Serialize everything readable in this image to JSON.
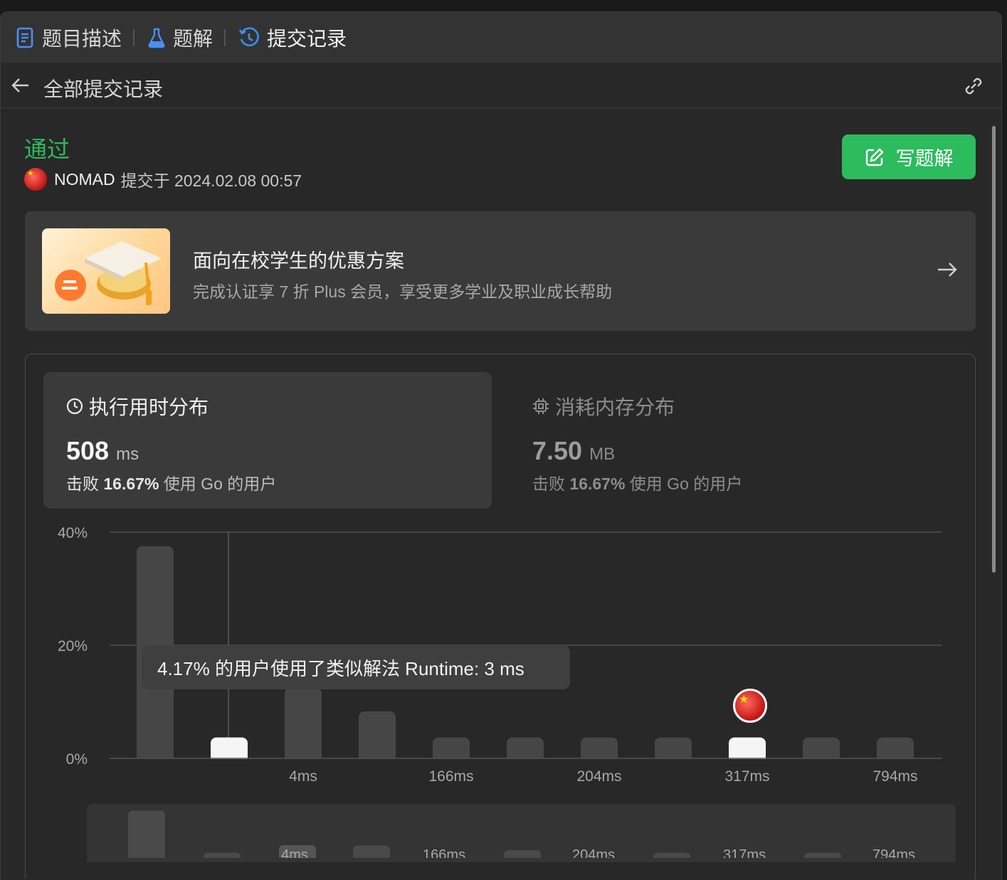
{
  "tabs": [
    {
      "label": "题目描述",
      "icon": "document-icon"
    },
    {
      "label": "题解",
      "icon": "flask-icon"
    },
    {
      "label": "提交记录",
      "icon": "history-icon"
    }
  ],
  "subheader": {
    "title": "全部提交记录"
  },
  "submission": {
    "status": "通过",
    "user": "NOMAD",
    "submitted_text": "提交于 2024.02.08 00:57",
    "status_color": "#2cbb5d"
  },
  "write_button": {
    "label": "写题解"
  },
  "promo": {
    "title": "面向在校学生的优惠方案",
    "subtitle": "完成认证享 7 折 Plus 会员，享受更多学业及职业成长帮助"
  },
  "stats": {
    "runtime": {
      "title": "执行用时分布",
      "value": "508",
      "unit": "ms",
      "beat_prefix": "击败",
      "beat_pct": "16.67%",
      "beat_suffix": "使用 Go 的用户"
    },
    "memory": {
      "title": "消耗内存分布",
      "value": "7.50",
      "unit": "MB",
      "beat_prefix": "击败",
      "beat_pct": "16.67%",
      "beat_suffix": "使用 Go 的用户"
    }
  },
  "tooltip": {
    "text": "4.17% 的用户使用了类似解法 Runtime: 3 ms"
  },
  "chart_data": {
    "type": "bar",
    "ylabel": "",
    "xlabel": "",
    "ylim": [
      0,
      40
    ],
    "y_ticks": [
      "40%",
      "20%",
      "0%"
    ],
    "grid": true,
    "x_tick_labels": [
      "4ms",
      "166ms",
      "204ms",
      "317ms",
      "794ms"
    ],
    "values": [
      37.5,
      3.7,
      12.5,
      8.3,
      3.7,
      3.7,
      3.7,
      3.7,
      3.7,
      3.7,
      3.7
    ],
    "highlighted_bars": [
      1,
      8
    ],
    "my_submission_bar": 8,
    "overview": {
      "values": [
        9.5,
        1.3,
        2.7,
        1.8,
        1.3,
        1.3,
        1.3
      ],
      "labels": [
        "4ms",
        "166ms",
        "204ms",
        "317ms",
        "794ms"
      ]
    },
    "colors": {
      "bar": "#464646",
      "highlight": "#f5f5f5",
      "grid": "#4d4d4d"
    }
  }
}
